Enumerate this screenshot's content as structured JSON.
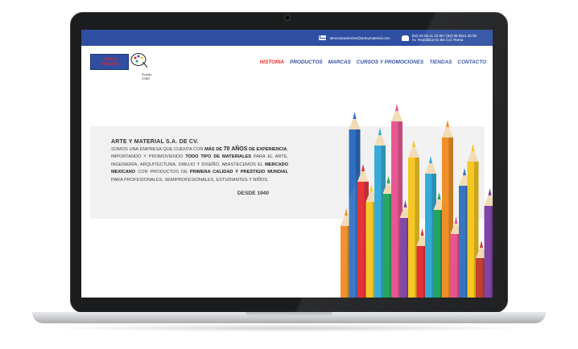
{
  "topbar": {
    "email": "atencionaclientes@arteymaterial.com",
    "phones_line1": "(52) 55 55 11 22 90 / (52) 55 5511 26 00",
    "phones_line2": "Av. República 51 Bis Col. Roma"
  },
  "logo": {
    "line1": "Arte y",
    "line2": "Material",
    "since_script": "Desde 1940"
  },
  "nav": {
    "items": [
      {
        "label": "HISTORIA",
        "active": true
      },
      {
        "label": "PRODUCTOS",
        "active": false
      },
      {
        "label": "MARCAS",
        "active": false
      },
      {
        "label": "CURSOS Y PROMOCIONES",
        "active": false
      },
      {
        "label": "TIENDAS",
        "active": false
      },
      {
        "label": "CONTACTO",
        "active": false
      }
    ]
  },
  "intro": {
    "company": "ARTE Y MATERIAL S.A. DE CV.",
    "p1": "Somos una empresa que cuenta con ",
    "b1": "más de ",
    "b1_big": "70 años",
    "b1_end": " de experiencia",
    "p2": ", importando y promoviendo ",
    "b2": "todo tipo de materiales",
    "p3": " para el arte, ingeniería, arquitectura, dibujo y diseño. Abastecemos el ",
    "b3": "mercado mexicano",
    "p4": " con productos de ",
    "b4": "primera calidad y prestigio mundial",
    "p5": " para profesionales, semiprofesionales, estudiantes y niños.",
    "since": "DESDE 1940"
  },
  "colors": {
    "brand_blue": "#2f4fa3",
    "accent_red": "#e3262b",
    "panel_gray": "#f1f1f1"
  },
  "pencils": [
    "#f08a1e",
    "#2f6fc1",
    "#e3262b",
    "#f5c518",
    "#2aa6d6",
    "#19a05a",
    "#e74c8b",
    "#7c3fa0",
    "#f5c518",
    "#e3262b",
    "#2aa6d6",
    "#19a05a",
    "#f08a1e",
    "#e74c8b",
    "#2f6fc1",
    "#f5c518",
    "#c0392b",
    "#7c3fa0"
  ]
}
